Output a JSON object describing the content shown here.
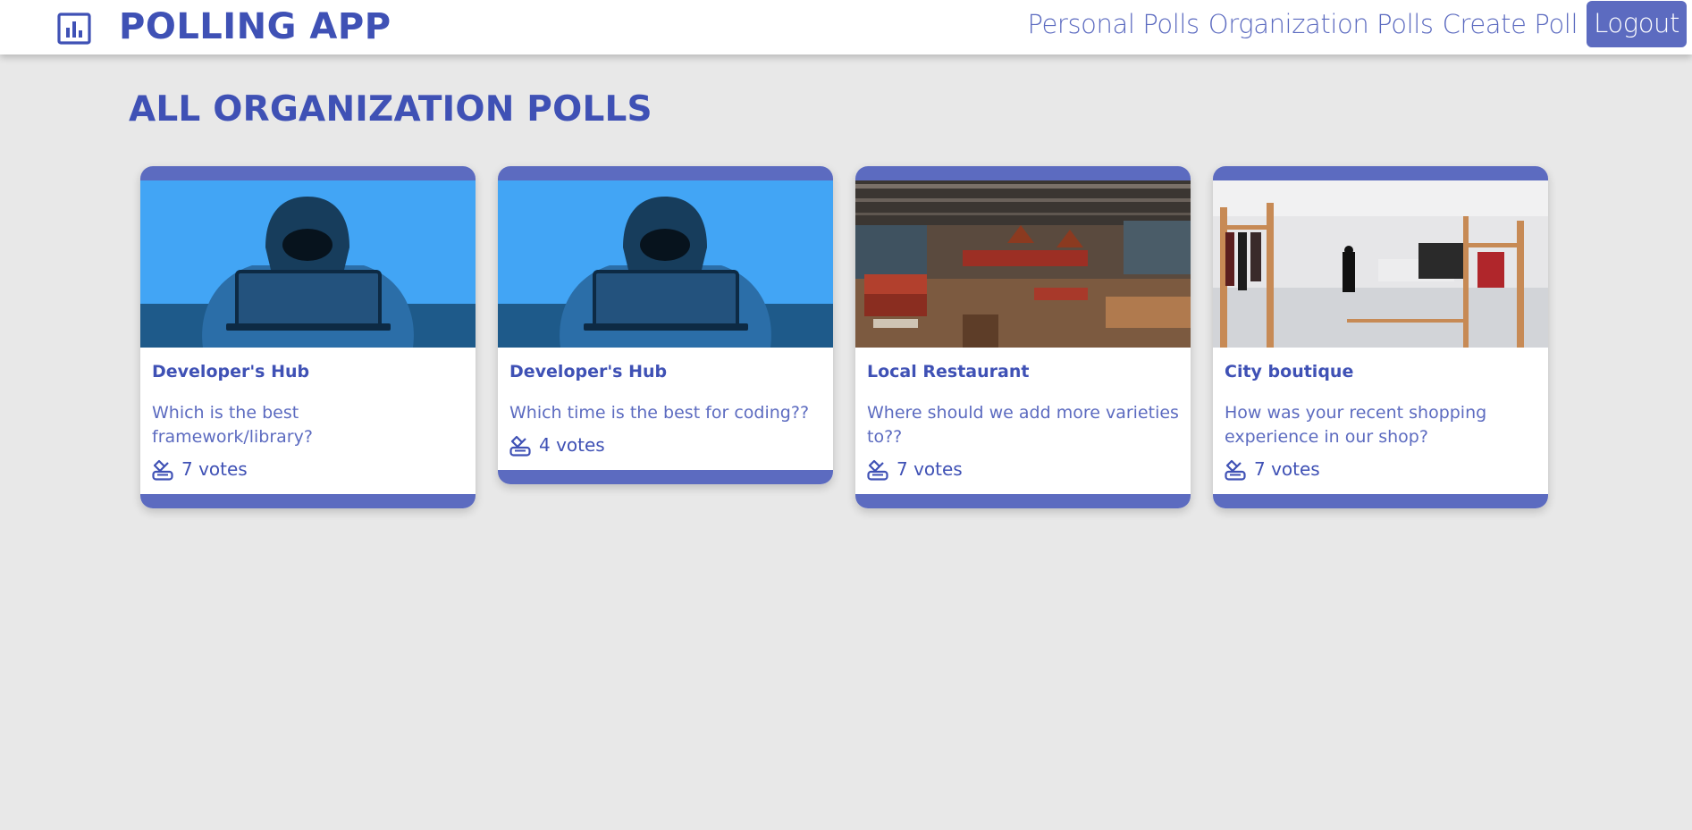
{
  "header": {
    "app_title": "POLLING APP",
    "logo_icon": "bar-chart-icon",
    "nav": {
      "personal_polls": "Personal Polls",
      "organization_polls": "Organization Polls",
      "create_poll": "Create Poll",
      "logout": "Logout"
    }
  },
  "page": {
    "title": "ALL ORGANIZATION POLLS"
  },
  "polls": [
    {
      "organization": "Developer's Hub",
      "question": "Which is the best framework/library?",
      "votes": "7 votes",
      "image": "hooded-coder-laptop"
    },
    {
      "organization": "Developer's Hub",
      "question": "Which time is the best for coding??",
      "votes": "4 votes",
      "image": "hooded-coder-laptop"
    },
    {
      "organization": "Local Restaurant",
      "question": "Where should we add more varieties to??",
      "votes": "7 votes",
      "image": "restaurant-interior"
    },
    {
      "organization": "City boutique",
      "question": "How was your recent shopping experience in our shop?",
      "votes": "7 votes",
      "image": "boutique-interior"
    }
  ],
  "colors": {
    "primary": "#3f51b5",
    "accent": "#5c6bc0",
    "background": "#e8e8e8",
    "sky": "#42a5f5"
  }
}
